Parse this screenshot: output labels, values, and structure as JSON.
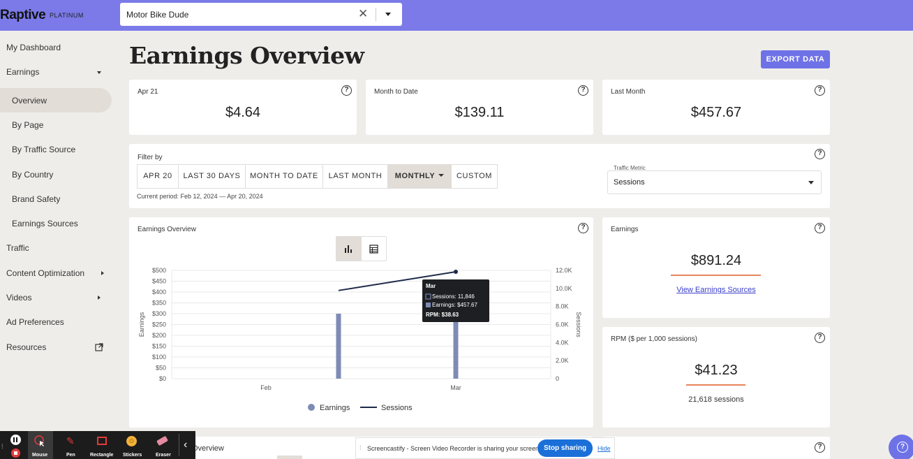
{
  "brand": {
    "logo": "Raptive",
    "tier": "PLATINUM"
  },
  "site_select": {
    "value": "Motor Bike Dude"
  },
  "sidebar": {
    "items": [
      {
        "label": "My Dashboard"
      },
      {
        "label": "Earnings"
      },
      {
        "label": "Overview"
      },
      {
        "label": "By Page"
      },
      {
        "label": "By Traffic Source"
      },
      {
        "label": "By Country"
      },
      {
        "label": "Brand Safety"
      },
      {
        "label": "Earnings Sources"
      },
      {
        "label": "Traffic"
      },
      {
        "label": "Content Optimization"
      },
      {
        "label": "Videos"
      },
      {
        "label": "Ad Preferences"
      },
      {
        "label": "Resources"
      }
    ]
  },
  "page": {
    "title": "Earnings Overview",
    "export_label": "EXPORT DATA"
  },
  "stats": [
    {
      "label": "Apr 21",
      "value": "$4.64"
    },
    {
      "label": "Month to Date",
      "value": "$139.11"
    },
    {
      "label": "Last Month",
      "value": "$457.67"
    }
  ],
  "filter": {
    "label": "Filter by",
    "buttons": [
      "APR 20",
      "LAST 30 DAYS",
      "MONTH TO DATE",
      "LAST MONTH",
      "MONTHLY",
      "CUSTOM"
    ],
    "current_period": "Current period: Feb 12, 2024 — Apr 20, 2024",
    "metric_label": "Traffic Metric",
    "metric_value": "Sessions"
  },
  "chart_card": {
    "title": "Earnings Overview"
  },
  "chart_data": {
    "type": "bar",
    "categories": [
      "Feb",
      "Mar"
    ],
    "series": [
      {
        "name": "Earnings",
        "type": "bar",
        "values": [
          300,
          457.67
        ],
        "axis": "left"
      },
      {
        "name": "Sessions",
        "type": "line",
        "values": [
          9770,
          11846
        ],
        "axis": "right"
      }
    ],
    "ylabel": "Earnings",
    "y2label": "Sessions",
    "ylim": [
      0,
      500
    ],
    "y2lim": [
      0,
      12000
    ],
    "yticks": [
      "$500",
      "$450",
      "$400",
      "$350",
      "$300",
      "$250",
      "$200",
      "$150",
      "$100",
      "$50",
      "$0"
    ],
    "y2ticks": [
      "12.0K",
      "10.0K",
      "8.0K",
      "6.0K",
      "4.0K",
      "2.0K",
      "0"
    ],
    "legend": "bottom",
    "tooltip": {
      "title": "Mar",
      "sessions": "Sessions: 11,846",
      "earnings": "Earnings: $457.67",
      "rpm": "RPM: $38.63"
    }
  },
  "earnings_card": {
    "title": "Earnings",
    "value": "$891.24",
    "link": "View Earnings Sources"
  },
  "rpm_card": {
    "title": "RPM ($ per 1,000 sessions)",
    "value": "$41.23",
    "sessions": "21,618 sessions"
  },
  "bottom_card": {
    "title": "Overview"
  },
  "recorder": {
    "tools": [
      "Mouse",
      "Pen",
      "Rectangle",
      "Stickers",
      "Eraser"
    ]
  },
  "share_bar": {
    "message": "Screencastify - Screen Video Recorder is sharing your screen.",
    "stop": "Stop sharing",
    "hide": "Hide"
  },
  "colors": {
    "topbar": "#7b7ae8",
    "accent": "#6e72e6",
    "bar": "#7d8bb5",
    "line": "#1f2a4a",
    "underline": "#e8845a"
  }
}
